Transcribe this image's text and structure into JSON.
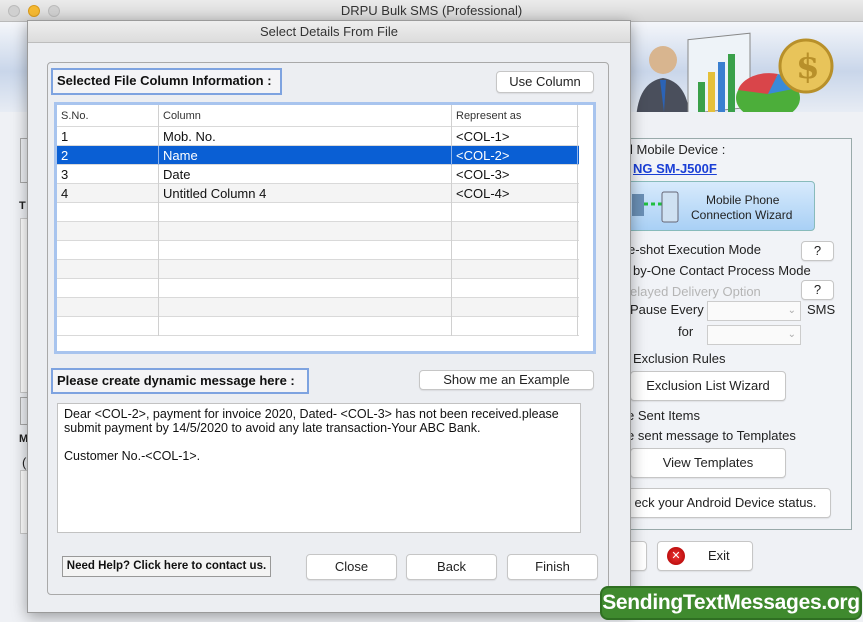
{
  "app": {
    "title": "DRPU Bulk SMS (Professional)"
  },
  "right_panel": {
    "device_label": "l Mobile Device :",
    "device_name": "NG SM-J500F",
    "wizard_line1": "Mobile Phone",
    "wizard_line2": "Connection  Wizard",
    "oneshot": "e-shot Execution Mode",
    "onebyone": "by-One Contact Process Mode",
    "delayed": "elayed Delivery Option",
    "help": "?",
    "pause_every": "Pause Every",
    "sms": "SMS",
    "for": "for",
    "exclusion_rules": "Exclusion Rules",
    "exclusion_wizard": "Exclusion List Wizard",
    "sent_items": "e Sent Items",
    "save_templates": "e sent message to Templates",
    "view_templates": "View Templates",
    "android_status": "eck your Android Device status.",
    "exit": "Exit"
  },
  "left_fragments": {
    "t": "T",
    "m": "M",
    "paren": "("
  },
  "dialog": {
    "title": "Select Details From File",
    "column_section_label": "Selected File Column Information :",
    "use_column": "Use Column",
    "table": {
      "headers": [
        "S.No.",
        "Column",
        "Represent as"
      ],
      "rows": [
        {
          "sno": "1",
          "column": "Mob. No.",
          "represent": "<COL-1>"
        },
        {
          "sno": "2",
          "column": "Name",
          "represent": "<COL-2>"
        },
        {
          "sno": "3",
          "column": "Date",
          "represent": "<COL-3>"
        },
        {
          "sno": "4",
          "column": "Untitled Column 4",
          "represent": "<COL-4>"
        }
      ],
      "selected_row": 2
    },
    "message_section_label": "Please create dynamic message here :",
    "show_example": "Show me an Example",
    "message": "Dear <COL-2>, payment for invoice 2020, Dated- <COL-3> has not been received.please\nsubmit payment by 14/5/2020 to avoid any late transaction-Your ABC Bank.\n\nCustomer No.-<COL-1>.",
    "help_link": "Need Help? Click here to contact us.",
    "close": "Close",
    "back": "Back",
    "finish": "Finish"
  },
  "watermark": "SendingTextMessages.org",
  "colors": {
    "selection": "#0a5fd4",
    "focus_border": "#7ea3e0",
    "watermark_bg": "#3f8a2e",
    "link": "#1a3fd6"
  }
}
